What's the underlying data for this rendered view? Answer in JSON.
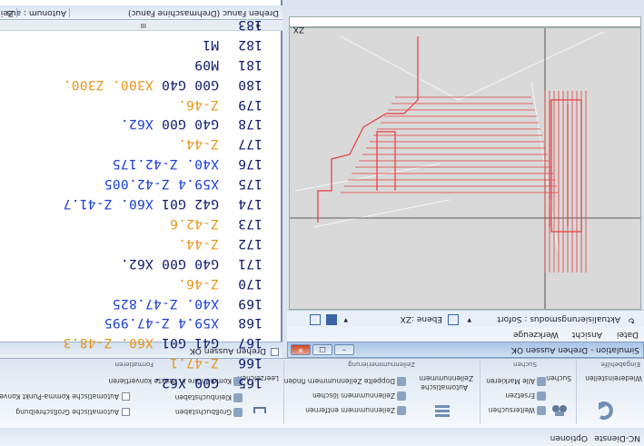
{
  "ribbon": {
    "tabs": [
      "NC-Dienste",
      "Optionen"
    ],
    "groups": [
      {
        "title": "Eingabehilfe",
        "items": [
          "Wiedereinstellen"
        ]
      },
      {
        "title": "Suchen",
        "items": [
          "Suchen",
          "Weitersuchen",
          "Ersetzen",
          "Alle Markieren"
        ]
      },
      {
        "title": "Zeilennummerierung",
        "items": [
          "Automatische",
          "Zeilennummern",
          "Zeilennummern entfernen",
          "Zeilennummern löschen",
          "Doppelte Zeilennummern finden"
        ]
      },
      {
        "title": "Formatieren",
        "items": [
          "Leerzeichen",
          "Großbuchstaben",
          "Kleinbuchstaben",
          "Kommentare in Punkte konvertieren",
          "Automatische Großschreibung",
          "Automatische Komma-Punkt Konvertierung"
        ]
      }
    ]
  },
  "simulation": {
    "window_title": "Simulation - Drehen Aussen OK",
    "menu": [
      "Datei",
      "Ansicht",
      "Werkzeuge"
    ],
    "toolbar": {
      "update_mode": "Aktualisierungsmodus : Sofort",
      "plane_label": "Ebene :",
      "plane_value": "ZX"
    },
    "axis_label": "ZX"
  },
  "editor": {
    "title": "Drehen Fanuc (Drehmaschine Fanuc)",
    "autonum": "Autonum : aus",
    "zeile": "Zei",
    "tab_label": "Drehen Aussen OK",
    "scroll_mark": "III",
    "lines": [
      {
        "n": "183",
        "parts": []
      },
      {
        "n": "182",
        "parts": [
          {
            "t": "M1",
            "c": "dk"
          }
        ]
      },
      {
        "n": "181",
        "parts": [
          {
            "t": "M09",
            "c": "dk"
          }
        ]
      },
      {
        "n": "180",
        "parts": [
          {
            "t": "G00 G40 ",
            "c": "dk"
          },
          {
            "t": "X300. Z300.",
            "c": "org"
          }
        ]
      },
      {
        "n": "179",
        "parts": [
          {
            "t": "Z-46.",
            "c": "org"
          }
        ]
      },
      {
        "n": "178",
        "parts": [
          {
            "t": "G40 G00 ",
            "c": "dk"
          },
          {
            "t": "X62.",
            "c": "cyan"
          }
        ]
      },
      {
        "n": "177",
        "parts": [
          {
            "t": "Z-44.",
            "c": "org"
          }
        ]
      },
      {
        "n": "176",
        "parts": [
          {
            "t": "X40. Z-42.175",
            "c": "cyan"
          }
        ]
      },
      {
        "n": "175",
        "parts": [
          {
            "t": "X59.4 Z-42.005",
            "c": "cyan"
          }
        ]
      },
      {
        "n": "174",
        "parts": [
          {
            "t": "G42 G01 ",
            "c": "dk"
          },
          {
            "t": "X60. Z-41.7",
            "c": "cyan"
          }
        ]
      },
      {
        "n": "173",
        "parts": [
          {
            "t": "Z-42.6",
            "c": "org"
          }
        ]
      },
      {
        "n": "172",
        "parts": [
          {
            "t": "Z-44.",
            "c": "org"
          }
        ]
      },
      {
        "n": "171",
        "parts": [
          {
            "t": "G40 G00 ",
            "c": "dk"
          },
          {
            "t": "X62.",
            "c": "dk"
          }
        ]
      },
      {
        "n": "170",
        "parts": [
          {
            "t": "Z-46.",
            "c": "org"
          }
        ]
      },
      {
        "n": "169",
        "parts": [
          {
            "t": "X40. Z-47.825",
            "c": "cyan"
          }
        ]
      },
      {
        "n": "168",
        "parts": [
          {
            "t": "X59.4 Z-47.995",
            "c": "cyan"
          }
        ]
      },
      {
        "n": "167",
        "parts": [
          {
            "t": "G41 G01 ",
            "c": "dk"
          },
          {
            "t": "X60. Z-48.3",
            "c": "org"
          }
        ]
      },
      {
        "n": "166",
        "parts": [
          {
            "t": "Z-47.1",
            "c": "org"
          }
        ]
      },
      {
        "n": "165",
        "parts": [
          {
            "t": "G00 X62.",
            "c": "dk"
          }
        ]
      }
    ]
  }
}
